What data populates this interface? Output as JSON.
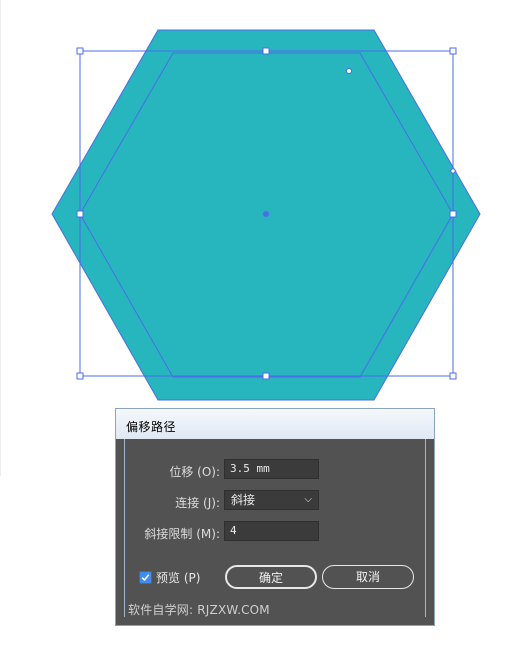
{
  "colors": {
    "hexagon_fill": "#27b5be",
    "selection": "#4a6de8",
    "dialog_bg": "#525252",
    "check_accent": "#3d8ef0"
  },
  "dialog": {
    "title": "偏移路径",
    "offset": {
      "label": "位移 (O):",
      "value": "3.5 mm"
    },
    "joins": {
      "label": "连接 (J):",
      "value": "斜接"
    },
    "miter_limit": {
      "label": "斜接限制 (M):",
      "value": "4"
    },
    "preview": {
      "label": "预览 (P)",
      "checked": true
    },
    "ok_label": "确定",
    "cancel_label": "取消",
    "watermark": "软件自学网: RJZXW.COM"
  }
}
